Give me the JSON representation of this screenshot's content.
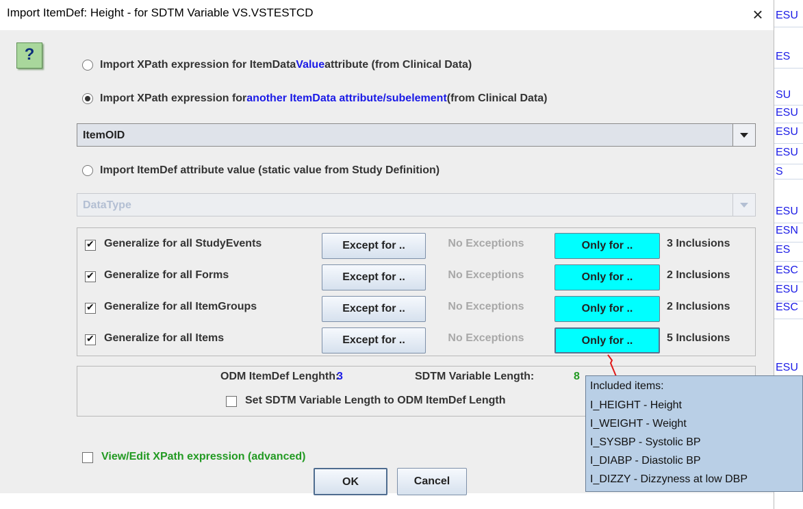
{
  "window": {
    "title": "Import ItemDef: Height - for SDTM Variable VS.VSTESTCD",
    "close_icon": "×"
  },
  "help": {
    "label": "?"
  },
  "options": {
    "value_attr": {
      "pre": "Import XPath expression for ItemData ",
      "highlight": "Value",
      "post": " attribute (from Clinical Data)"
    },
    "other_attr": {
      "pre": "Import XPath expression for ",
      "highlight": "another ItemData attribute/subelement",
      "post": " (from Clinical Data)"
    },
    "other_attr_select": "ItemOID",
    "itemdef_attr": {
      "label": "Import ItemDef attribute value (static value from Study Definition)"
    },
    "itemdef_attr_select": "DataType"
  },
  "generalize": [
    {
      "label": "Generalize for all StudyEvents",
      "except": "Except for ..",
      "exceptions": "No Exceptions",
      "only": "Only for ..",
      "inclusions": "3 Inclusions"
    },
    {
      "label": "Generalize for all Forms",
      "except": "Except for ..",
      "exceptions": "No Exceptions",
      "only": "Only for ..",
      "inclusions": "2 Inclusions"
    },
    {
      "label": "Generalize for all ItemGroups",
      "except": "Except for ..",
      "exceptions": "No Exceptions",
      "only": "Only for ..",
      "inclusions": "2 Inclusions"
    },
    {
      "label": "Generalize for all Items",
      "except": "Except for ..",
      "exceptions": "No Exceptions",
      "only": "Only for ..",
      "inclusions": "5 Inclusions"
    }
  ],
  "lengths": {
    "odm_label": "ODM ItemDef Lenghth:",
    "odm_value": "3",
    "sdtm_label": "SDTM Variable Length:",
    "sdtm_value": "8",
    "set_label": "Set SDTM Variable Length to ODM ItemDef Length"
  },
  "xpath_edit": "View/Edit XPath expression (advanced)",
  "buttons": {
    "ok": "OK",
    "cancel": "Cancel"
  },
  "tooltip": {
    "header": "Included items:",
    "items": [
      "I_HEIGHT - Height",
      "I_WEIGHT - Weight",
      "I_SYSBP - Systolic BP",
      "I_DIABP - Diastolic BP",
      "I_DIZZY - Dizzyness at low DBP"
    ]
  },
  "background_cells": [
    "ESU",
    "ES",
    "SU",
    "ESU",
    "ESU",
    "ESU",
    "S",
    "ESU",
    "ESN",
    "ES",
    "ESC",
    "ESU",
    "ESC",
    "ESU"
  ],
  "colors": {
    "accent_blue": "#1a1ae6",
    "only_button": "#00ffff",
    "green_text": "#229a22",
    "tooltip_bg": "#b9cfe6"
  }
}
